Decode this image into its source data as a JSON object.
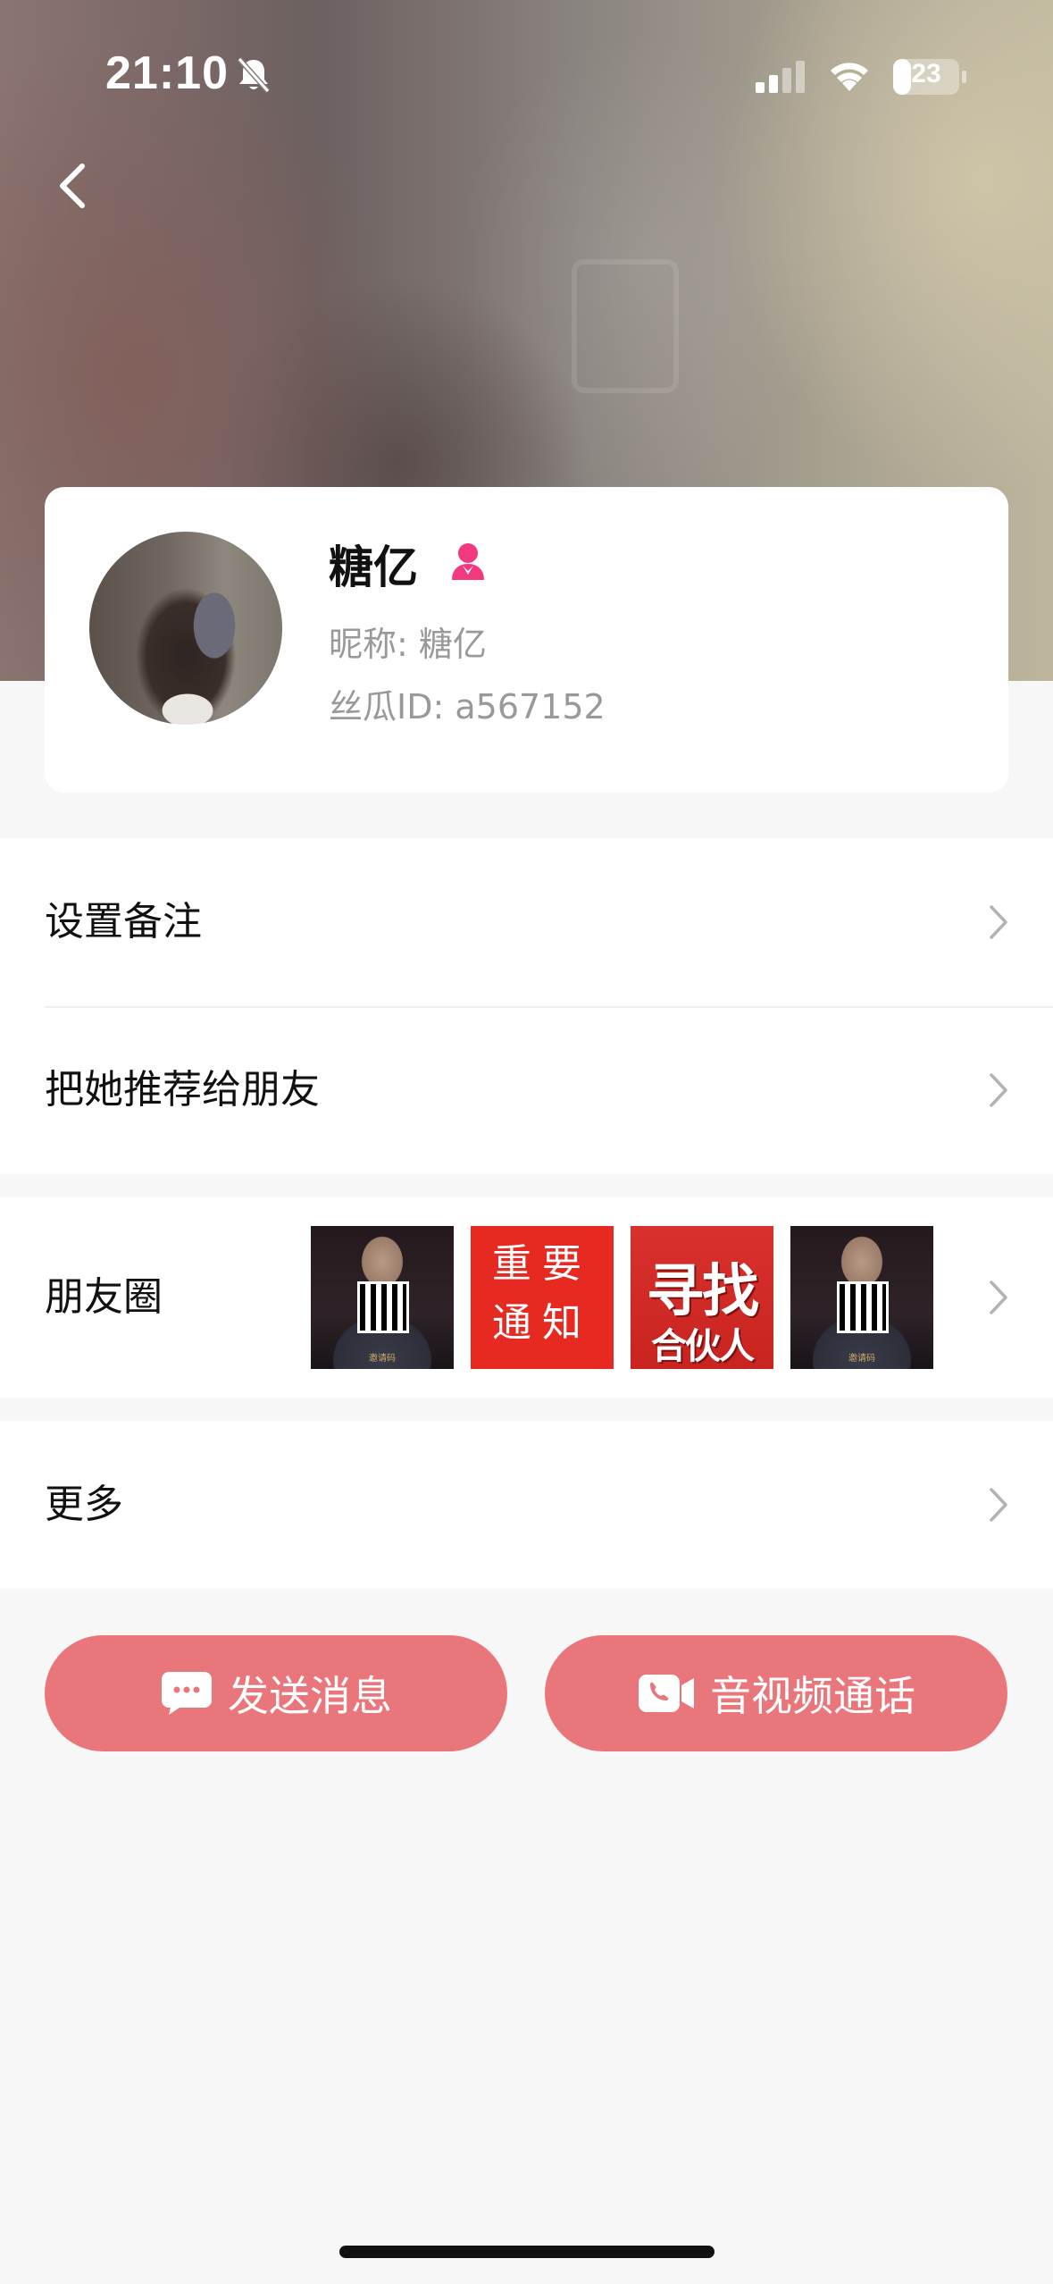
{
  "status_bar": {
    "time": "21:10",
    "battery": "23",
    "icons": [
      "bell-off-icon",
      "signal-icon",
      "wifi-icon",
      "battery-icon"
    ]
  },
  "nav": {
    "back_icon": "chevron-left-icon"
  },
  "profile": {
    "name": "糖亿",
    "gender_icon": "female-icon",
    "gender_color": "#f2387e",
    "nickname": "昵称: 糖亿",
    "user_id": "丝瓜ID: a567152"
  },
  "menu": {
    "set_remark": "设置备注",
    "recommend": "把她推荐给朋友",
    "moments": "朋友圈",
    "more": "更多"
  },
  "moments_thumbs": {
    "qr_caption": "邀请码",
    "notice": "重要通知",
    "partner_line1": "寻找",
    "partner_line2": "合伙人"
  },
  "actions": {
    "send_message": "发送消息",
    "av_call": "音视频通话",
    "accent": "#e8767b"
  }
}
